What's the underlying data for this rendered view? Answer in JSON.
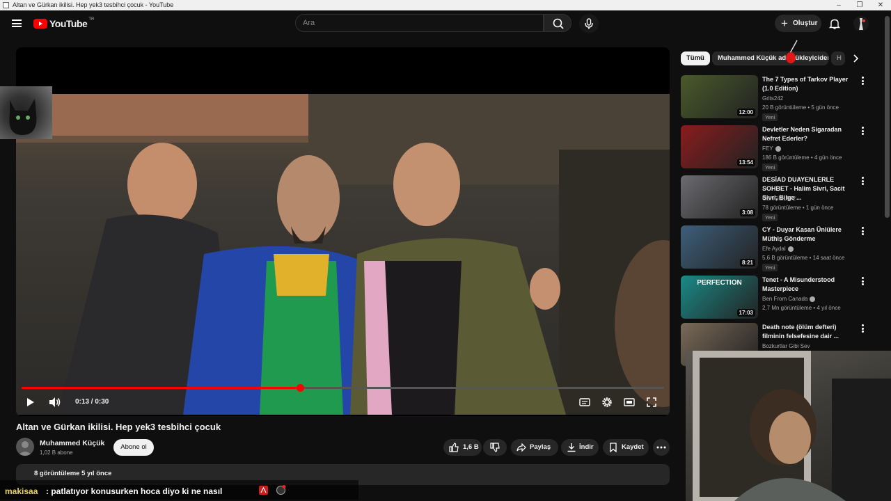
{
  "window": {
    "title": "Altan ve Gürkan ikilisi. Hep yek3 tesbihci çocuk - YouTube",
    "buttons": [
      "–",
      "❐",
      "✕"
    ]
  },
  "masthead": {
    "logo_text": "YouTube",
    "region": "TR",
    "search_placeholder": "Ara",
    "create_label": "Oluştur",
    "icons": [
      "menu-icon",
      "search-icon",
      "microphone-icon",
      "plus-icon",
      "bell-icon"
    ]
  },
  "player": {
    "current_time": "0:13",
    "duration": "0:30",
    "time_display": "0:13 / 0:30",
    "progress_fraction": 0.433,
    "colors": {
      "progress": "#ff0000",
      "track": "#555555"
    }
  },
  "video": {
    "title": "Altan ve Gürkan ikilisi. Hep yek3 tesbihci çocuk",
    "channel": "Muhammed Küçük",
    "subscribers": "1,02 B abone",
    "subscribe_label": "Abone ol",
    "likes": "1,6 B",
    "share_label": "Paylaş",
    "download_label": "İndir",
    "save_label": "Kaydet",
    "views_date": "8 görüntüleme  5 yıl önce"
  },
  "chips": [
    {
      "label": "Tümü",
      "active": true
    },
    {
      "label": "Muhammed Küçük adlı yükleyiciden",
      "active": false
    },
    {
      "label": "H",
      "active": false
    }
  ],
  "recommendations": [
    {
      "title": "The 7 Types of Tarkov Player (1.0 Edition)",
      "channel": "Grits242",
      "verified": false,
      "meta": "20 B görüntüleme • 5 gün önce",
      "duration": "12:00",
      "badge": "Yeni",
      "thumb_color": "#4a5a2a"
    },
    {
      "title": "Devletler Neden Sigaradan Nefret Ederler?",
      "channel": "FEY",
      "verified": true,
      "meta": "186 B görüntüleme • 4 gün önce",
      "duration": "13:54",
      "badge": "Yeni",
      "thumb_color": "#8a1c1c"
    },
    {
      "title": "DESİAD DUAYENLERLE SOHBET - Halim Sivri, Sacit Sivri, Bilge ...",
      "channel": "CENGİZ1972",
      "verified": false,
      "meta": "78 görüntüleme • 1 gün önce",
      "duration": "3:08",
      "badge": "Yeni",
      "thumb_color": "#6b6b70"
    },
    {
      "title": "CY - Duyar Kasan Ünlülere Müthiş Gönderme",
      "channel": "Efe Aydal",
      "verified": true,
      "meta": "5,6 B görüntüleme • 14 saat önce",
      "duration": "8:21",
      "badge": "Yeni",
      "thumb_color": "#3d5f7a"
    },
    {
      "title": "Tenet - A Misunderstood Masterpiece",
      "channel": "Ben From Canada",
      "verified": true,
      "meta": "2,7 Mn görüntüleme • 4 yıl önce",
      "duration": "17:03",
      "badge": "",
      "thumb_color": "#1a8a86",
      "thumb_text": "PERFECTION"
    },
    {
      "title": "Death note (ölüm defteri) filminin felsefesine dair ...",
      "channel": "Bozkurtlar Gibi Sev",
      "verified": false,
      "meta": "",
      "duration": "",
      "badge": "",
      "thumb_color": "#7a6a58"
    }
  ],
  "chat": {
    "user": "makisaa",
    "message": ": patlatıyor konusurken hoca diyo ki ne nasıl"
  }
}
